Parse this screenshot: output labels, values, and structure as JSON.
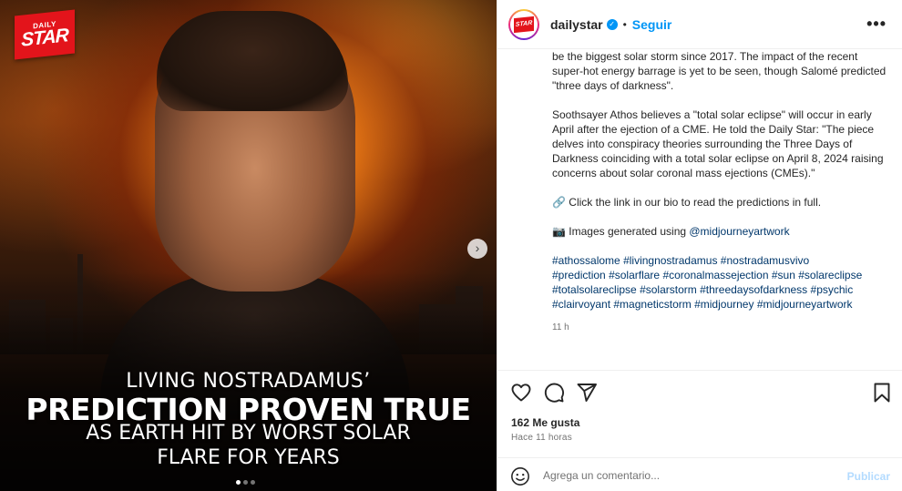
{
  "media": {
    "brand_top": "DAILY",
    "brand_bottom": "STAR",
    "headline": {
      "line1": "LIVING NOSTRADAMUS’",
      "line2": "PREDICTION PROVEN TRUE",
      "line3": "AS EARTH HIT BY WORST SOLAR",
      "line4": "FLARE FOR YEARS"
    },
    "next_icon": "chevron-right-icon",
    "carousel_total": 3,
    "carousel_active": 1
  },
  "post": {
    "username": "dailystar",
    "verified_icon": "verified-icon",
    "separator": "•",
    "follow_label": "Seguir",
    "more_label": "•••"
  },
  "caption": {
    "p1": "be the biggest solar storm since 2017. The impact of the recent super-hot energy barrage is yet to be seen, though Salomé predicted \"three days of darkness\".",
    "p2": "Soothsayer Athos believes a \"total solar eclipse\" will occur in early April after the ejection of a CME. He told the Daily Star: \"The piece delves into conspiracy theories surrounding the Three Days of Darkness coinciding with a total solar eclipse on April 8, 2024 raising concerns about solar coronal mass ejections (CMEs).\"",
    "p3_emoji": "🔗",
    "p3": " Click the link in our bio to read the predictions in full.",
    "p4_emoji": "📷",
    "p4": " Images generated using ",
    "p4_mention": "@midjourneyartwork",
    "hashtags": [
      "#athossalome",
      "#livingnostradamus",
      "#nostradamusvivo",
      "#prediction",
      "#solarflare",
      "#coronalmassejection",
      "#sun",
      "#solareclipse",
      "#totalsolareclipse",
      "#solarstorm",
      "#threedaysofdarkness",
      "#psychic",
      "#clairvoyant",
      "#magneticstorm",
      "#midjourney",
      "#midjourneyartwork"
    ],
    "time": "11 h"
  },
  "actions": {
    "like_icon": "heart-icon",
    "comment_icon": "comment-icon",
    "share_icon": "share-icon",
    "save_icon": "bookmark-icon"
  },
  "stats": {
    "likes": "162 Me gusta",
    "ago": "Hace 11 horas"
  },
  "comment": {
    "emoji_icon": "emoji-icon",
    "placeholder": "Agrega un comentario...",
    "publish_label": "Publicar"
  }
}
